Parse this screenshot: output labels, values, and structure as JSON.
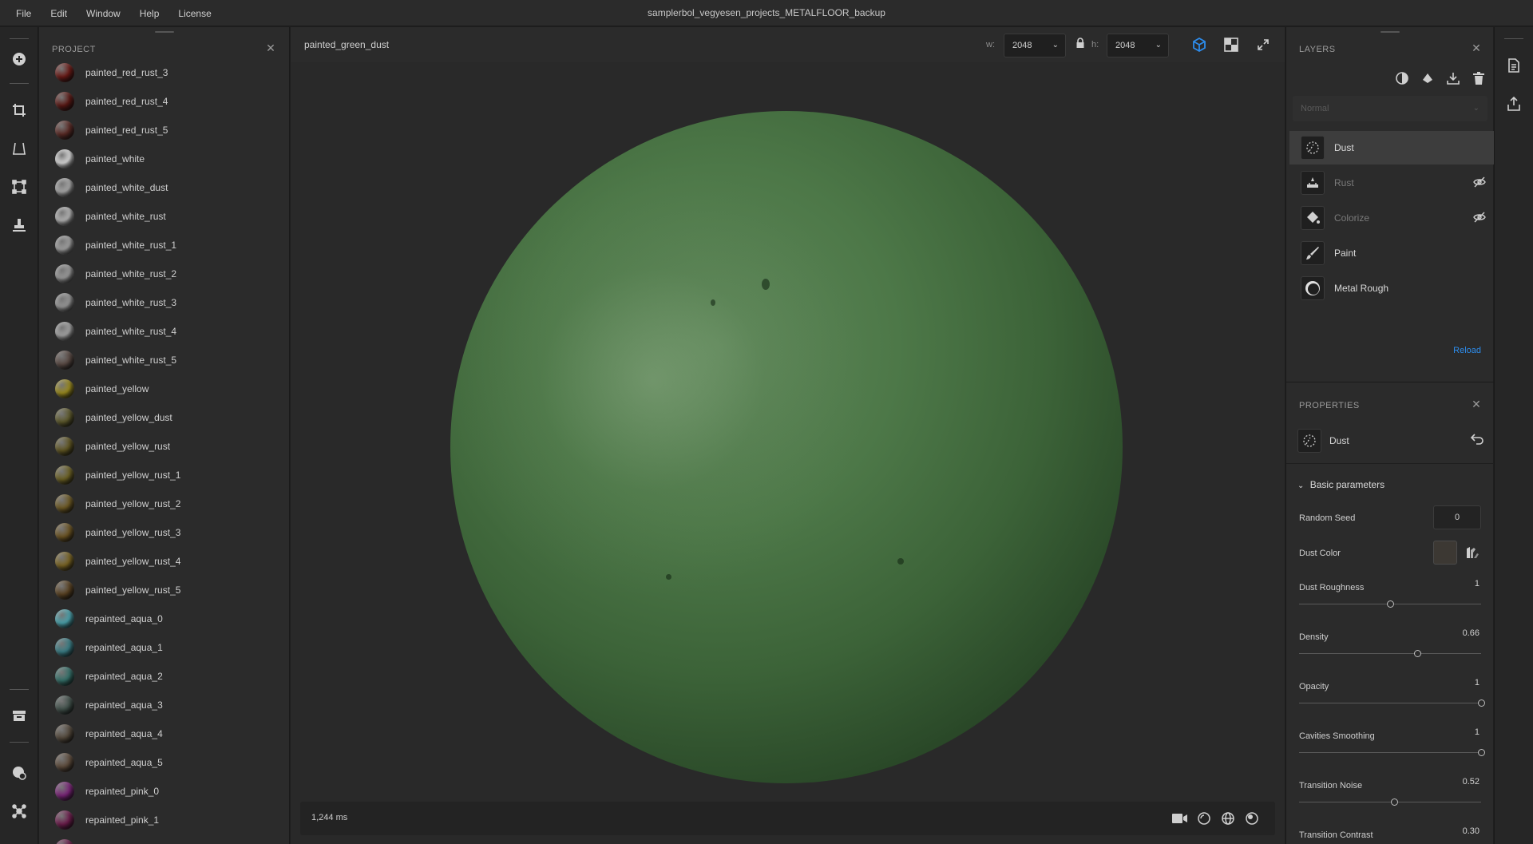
{
  "menu": [
    "File",
    "Edit",
    "Window",
    "Help",
    "License"
  ],
  "app_title": "samplerbol_vegyesen_projects_METALFLOOR_backup",
  "project": {
    "header": "PROJECT",
    "materials": [
      {
        "label": "painted_red_rust_3",
        "color": "#6a1a16"
      },
      {
        "label": "painted_red_rust_4",
        "color": "#5a1814"
      },
      {
        "label": "painted_red_rust_5",
        "color": "#5a2a25"
      },
      {
        "label": "painted_white",
        "color": "#d8d8d8"
      },
      {
        "label": "painted_white_dust",
        "color": "#a8a8a8"
      },
      {
        "label": "painted_white_rust",
        "color": "#b4b4b4"
      },
      {
        "label": "painted_white_rust_1",
        "color": "#a0a0a0"
      },
      {
        "label": "painted_white_rust_2",
        "color": "#9a9a9a"
      },
      {
        "label": "painted_white_rust_3",
        "color": "#979797"
      },
      {
        "label": "painted_white_rust_4",
        "color": "#a3a3a3"
      },
      {
        "label": "painted_white_rust_5",
        "color": "#5a4a44"
      },
      {
        "label": "painted_yellow",
        "color": "#9a8a1e"
      },
      {
        "label": "painted_yellow_dust",
        "color": "#5e5a2c"
      },
      {
        "label": "painted_yellow_rust",
        "color": "#605622"
      },
      {
        "label": "painted_yellow_rust_1",
        "color": "#6c6124"
      },
      {
        "label": "painted_yellow_rust_2",
        "color": "#6e5a24"
      },
      {
        "label": "painted_yellow_rust_3",
        "color": "#6c5422"
      },
      {
        "label": "painted_yellow_rust_4",
        "color": "#7a6422"
      },
      {
        "label": "painted_yellow_rust_5",
        "color": "#5a4222"
      },
      {
        "label": "repainted_aqua_0",
        "color": "#4aa2ac"
      },
      {
        "label": "repainted_aqua_1",
        "color": "#3a7e86"
      },
      {
        "label": "repainted_aqua_2",
        "color": "#35716a"
      },
      {
        "label": "repainted_aqua_3",
        "color": "#42524c"
      },
      {
        "label": "repainted_aqua_4",
        "color": "#54493c"
      },
      {
        "label": "repainted_aqua_5",
        "color": "#5e4c3c"
      },
      {
        "label": "repainted_pink_0",
        "color": "#7a2478"
      },
      {
        "label": "repainted_pink_1",
        "color": "#6c1c4c"
      },
      {
        "label": "",
        "color": "#6a1c4a"
      }
    ]
  },
  "viewport": {
    "document_name": "painted_green_dust",
    "width_label": "w:",
    "width_value": "2048",
    "height_label": "h:",
    "height_value": "2048",
    "render_time": "1,244 ms",
    "accent_color": "#2d8ceb"
  },
  "layers": {
    "header": "LAYERS",
    "blend_mode": "Normal",
    "items": [
      {
        "name": "Dust",
        "icon": "dust-icon",
        "active": true,
        "hidden": false
      },
      {
        "name": "Rust",
        "icon": "rust-icon",
        "active": false,
        "hidden": true
      },
      {
        "name": "Colorize",
        "icon": "bucket-icon",
        "active": false,
        "hidden": true
      },
      {
        "name": "Paint",
        "icon": "brush-icon",
        "active": false,
        "hidden": false
      },
      {
        "name": "Metal Rough",
        "icon": "sphere-material-icon",
        "active": false,
        "hidden": false
      }
    ],
    "reload_label": "Reload"
  },
  "properties": {
    "header": "PROPERTIES",
    "layer_name": "Dust",
    "section_title": "Basic parameters",
    "random_seed_label": "Random Seed",
    "random_seed_value": "0",
    "dust_color_label": "Dust Color",
    "dust_color": "#3c3833",
    "sliders": [
      {
        "label": "Dust Roughness",
        "value": "1",
        "fraction": 0.5
      },
      {
        "label": "Density",
        "value": "0.66",
        "fraction": 0.65
      },
      {
        "label": "Opacity",
        "value": "1",
        "fraction": 1.0
      },
      {
        "label": "Cavities Smoothing",
        "value": "1",
        "fraction": 1.0
      },
      {
        "label": "Transition Noise",
        "value": "0.52",
        "fraction": 0.52
      },
      {
        "label": "Transition Contrast",
        "value": "0.30",
        "fraction": 0.3
      }
    ]
  }
}
